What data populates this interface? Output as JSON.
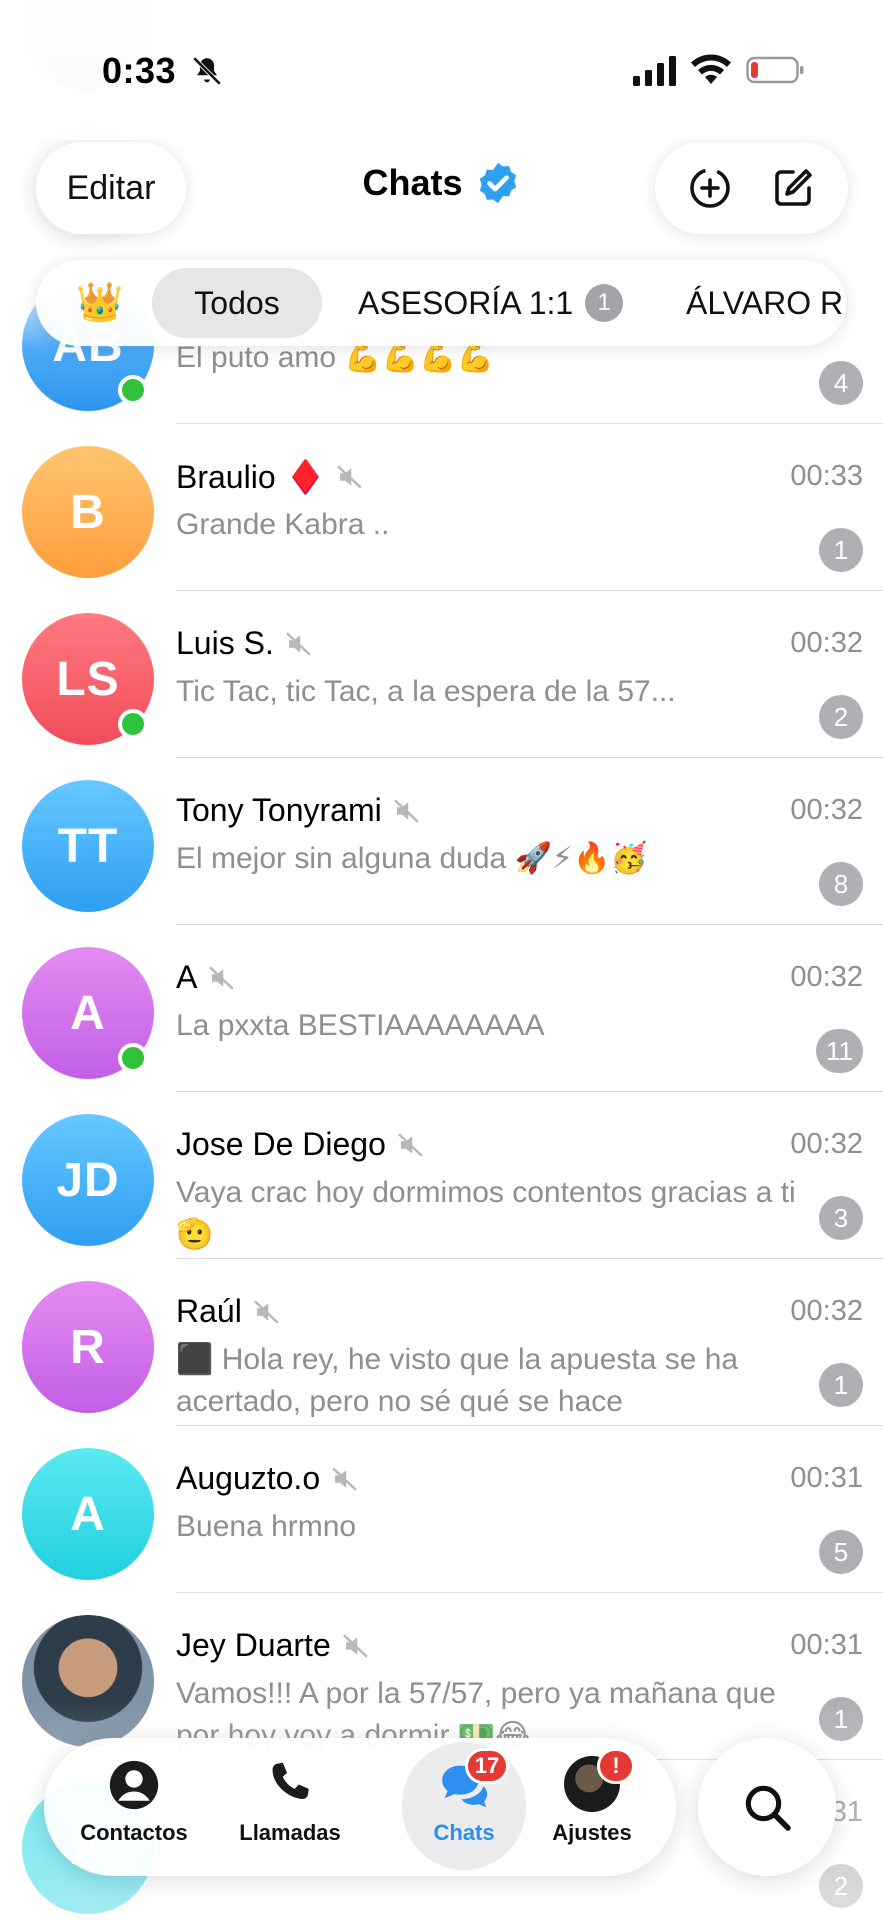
{
  "status_bar": {
    "time": "0:33"
  },
  "header": {
    "edit_label": "Editar",
    "title": "Chats"
  },
  "filters": {
    "crown": "👑",
    "tabs": [
      {
        "label": "Todos",
        "active": true
      },
      {
        "label": "ASESORÍA 1:1",
        "badge": "1"
      },
      {
        "label": "ÁLVARO R"
      }
    ]
  },
  "chats": [
    {
      "initials": "AB",
      "name": "",
      "message": "El puto amo 💪💪💪💪",
      "time": "",
      "unread": "4",
      "muted": false,
      "online": true,
      "color_from": "#6cc0ff",
      "color_to": "#2e95ef"
    },
    {
      "initials": "B",
      "name": "Braulio",
      "name_suffix": "♦️",
      "message": "Grande Kabra ..",
      "time": "00:33",
      "unread": "1",
      "muted": true,
      "online": false,
      "color_from": "#ffc46e",
      "color_to": "#ff9e3d"
    },
    {
      "initials": "LS",
      "name": "Luis S.",
      "message": "Tic Tac, tic Tac, a la espera de la 57...",
      "time": "00:32",
      "unread": "2",
      "muted": true,
      "online": true,
      "color_from": "#ff7a80",
      "color_to": "#f04d5c"
    },
    {
      "initials": "TT",
      "name": "Tony Tonyrami",
      "message": "El mejor sin alguna duda 🚀⚡🔥🥳",
      "time": "00:32",
      "unread": "8",
      "muted": true,
      "online": false,
      "color_from": "#66c8ff",
      "color_to": "#2e9ff2"
    },
    {
      "initials": "A",
      "name": "A",
      "message": "La pxxta BESTIAAAAAAAA",
      "time": "00:32",
      "unread": "11",
      "muted": true,
      "online": true,
      "color_from": "#e58bf2",
      "color_to": "#c25ee6"
    },
    {
      "initials": "JD",
      "name": "Jose De Diego",
      "message": "Vaya crac hoy dormimos contentos gracias a ti 🫡",
      "time": "00:32",
      "unread": "3",
      "muted": true,
      "online": false,
      "color_from": "#66c8ff",
      "color_to": "#2e9ff2"
    },
    {
      "initials": "R",
      "name": "Raúl",
      "message": "⬛ Hola rey, he visto que la apuesta se ha acertado, pero no sé qué se hace",
      "time": "00:32",
      "unread": "1",
      "muted": true,
      "online": false,
      "color_from": "#e58bf2",
      "color_to": "#c25ee6"
    },
    {
      "initials": "A",
      "name": "Auguzto.o",
      "message": "Buena hrmno",
      "time": "00:31",
      "unread": "5",
      "muted": true,
      "online": false,
      "color_from": "#5be9f0",
      "color_to": "#22cfe0"
    },
    {
      "initials": "",
      "name": "Jey Duarte",
      "message": "Vamos!!! A por la 57/57, pero ya mañana que por hoy voy a dormir 💵😂",
      "time": "00:31",
      "unread": "1",
      "muted": true,
      "online": false,
      "photo": true
    },
    {
      "initials": "A",
      "name": "",
      "message": "",
      "time": "31",
      "unread": "2",
      "muted": false,
      "online": false,
      "color_from": "#5be9f0",
      "color_to": "#22cfe0"
    }
  ],
  "tabbar": {
    "contacts_label": "Contactos",
    "calls_label": "Llamadas",
    "chats_label": "Chats",
    "chats_badge": "17",
    "settings_label": "Ajustes",
    "settings_badge": "!"
  }
}
